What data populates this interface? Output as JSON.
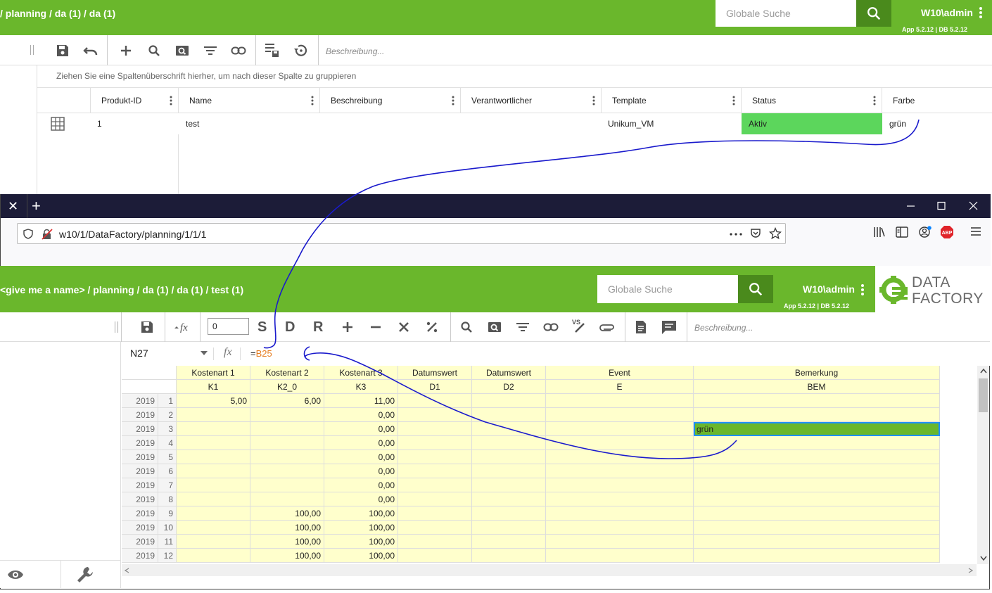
{
  "bg": {
    "breadcrumb": "/ planning / da (1) / da (1)",
    "search_placeholder": "Globale Suche",
    "user": "W10\\admin",
    "version": "App 5.2.12 | DB 5.2.12",
    "description_placeholder": "Beschreibung...",
    "group_hint": "Ziehen Sie eine Spaltenüberschrift hierher, um nach dieser Spalte zu gruppieren",
    "columns": [
      "Produkt-ID",
      "Name",
      "Beschreibung",
      "Verantwortlicher",
      "Template",
      "Status",
      "Farbe"
    ],
    "row": {
      "id": "1",
      "name": "test",
      "beschreibung": "",
      "verantwortlicher": "",
      "template": "Unikum_VM",
      "status": "Aktiv",
      "farbe": "grün"
    },
    "status_color": "#5cd65c"
  },
  "browser": {
    "url": "w10/1/DataFactory/planning/1/1/1",
    "new_tab": "+"
  },
  "app": {
    "breadcrumb": "<give me a name> / planning / da (1) / da (1) / test (1)",
    "search_placeholder": "Globale Suche",
    "user": "W10\\admin",
    "version": "App 5.2.12 | DB 5.2.12",
    "logo_line1": "DATA",
    "logo_line2": "FACTORY",
    "precision": "0",
    "letters": [
      "S",
      "D",
      "R"
    ],
    "description_placeholder": "Beschreibung...",
    "cell_ref": "N27",
    "formula_eq": "=",
    "formula_ref": "B25",
    "brand_color": "#6ab72c"
  },
  "sheet": {
    "header1": [
      "Kostenart 1",
      "Kostenart 2",
      "Kostenart 3",
      "Datumswert",
      "Datumswert",
      "Event",
      "Bemerkung"
    ],
    "header2": [
      "K1",
      "K2_0",
      "K3",
      "D1",
      "D2",
      "E",
      "BEM"
    ],
    "rows": [
      {
        "year": "2019",
        "n": "1",
        "k1": "5,00",
        "k2": "6,00",
        "k3": "11,00",
        "bem": ""
      },
      {
        "year": "2019",
        "n": "2",
        "k1": "",
        "k2": "",
        "k3": "0,00",
        "bem": ""
      },
      {
        "year": "2019",
        "n": "3",
        "k1": "",
        "k2": "",
        "k3": "0,00",
        "bem": "grün"
      },
      {
        "year": "2019",
        "n": "4",
        "k1": "",
        "k2": "",
        "k3": "0,00",
        "bem": ""
      },
      {
        "year": "2019",
        "n": "5",
        "k1": "",
        "k2": "",
        "k3": "0,00",
        "bem": ""
      },
      {
        "year": "2019",
        "n": "6",
        "k1": "",
        "k2": "",
        "k3": "0,00",
        "bem": ""
      },
      {
        "year": "2019",
        "n": "7",
        "k1": "",
        "k2": "",
        "k3": "0,00",
        "bem": ""
      },
      {
        "year": "2019",
        "n": "8",
        "k1": "",
        "k2": "",
        "k3": "0,00",
        "bem": ""
      },
      {
        "year": "2019",
        "n": "9",
        "k1": "",
        "k2": "100,00",
        "k3": "100,00",
        "bem": ""
      },
      {
        "year": "2019",
        "n": "10",
        "k1": "",
        "k2": "100,00",
        "k3": "100,00",
        "bem": ""
      },
      {
        "year": "2019",
        "n": "11",
        "k1": "",
        "k2": "100,00",
        "k3": "100,00",
        "bem": ""
      },
      {
        "year": "2019",
        "n": "12",
        "k1": "",
        "k2": "100,00",
        "k3": "100,00",
        "bem": ""
      }
    ],
    "highlight_color": "#6ab72c",
    "cell_color": "#ffffcc"
  }
}
